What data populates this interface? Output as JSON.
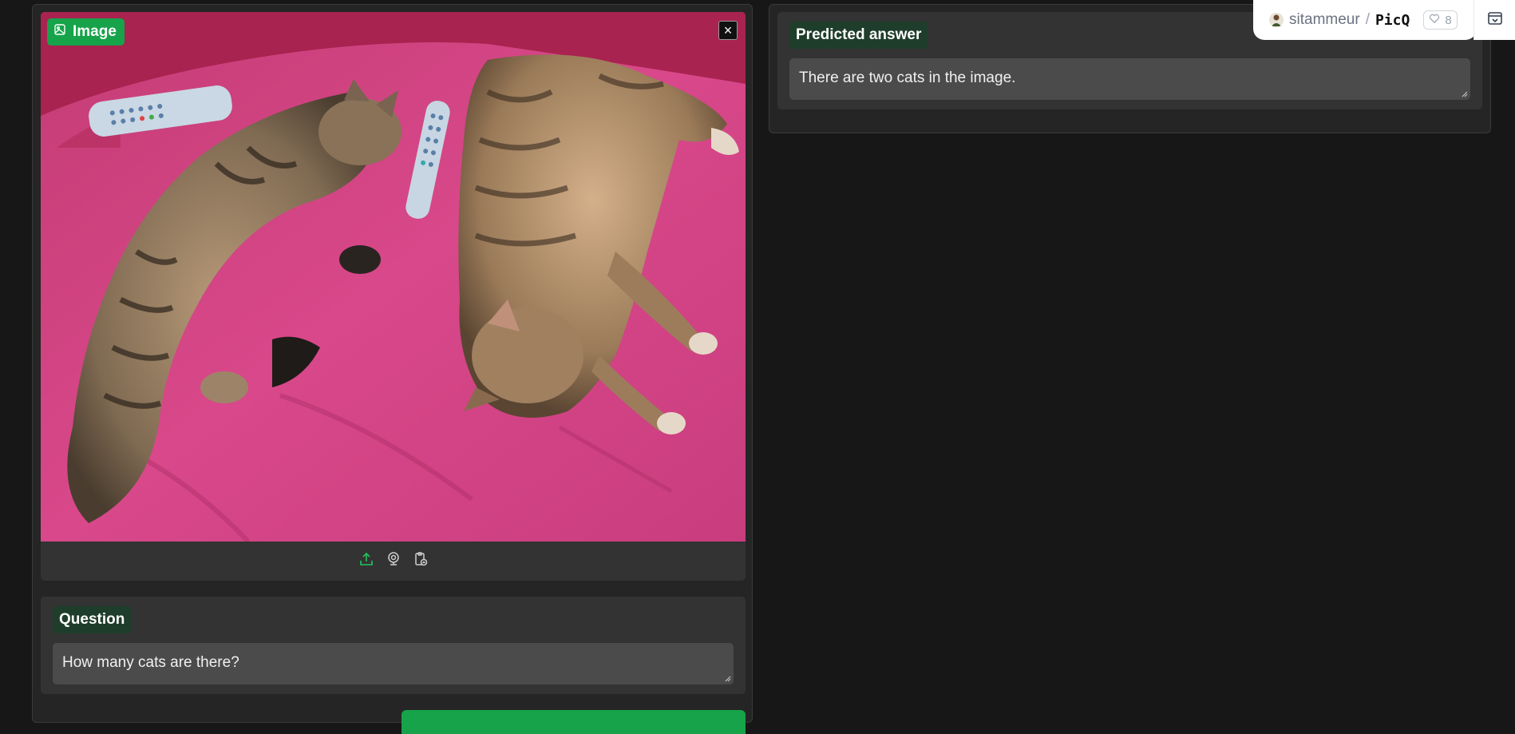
{
  "image_input": {
    "label": "Image",
    "close_symbol": "×",
    "toolbar_icons": [
      "upload-icon",
      "webcam-icon",
      "clipboard-icon"
    ]
  },
  "question": {
    "label": "Question",
    "value": "How many cats are there?"
  },
  "answer": {
    "label": "Predicted answer",
    "value": "There are two cats in the image."
  },
  "space": {
    "owner": "sitammeur",
    "separator": "/",
    "name": "PicQ",
    "likes": "8"
  },
  "colors": {
    "accent": "#16a34a",
    "label_bg": "#1f3d2b",
    "panel_bg": "#252525",
    "block_bg": "#333333",
    "input_bg": "#4b4b4b"
  }
}
